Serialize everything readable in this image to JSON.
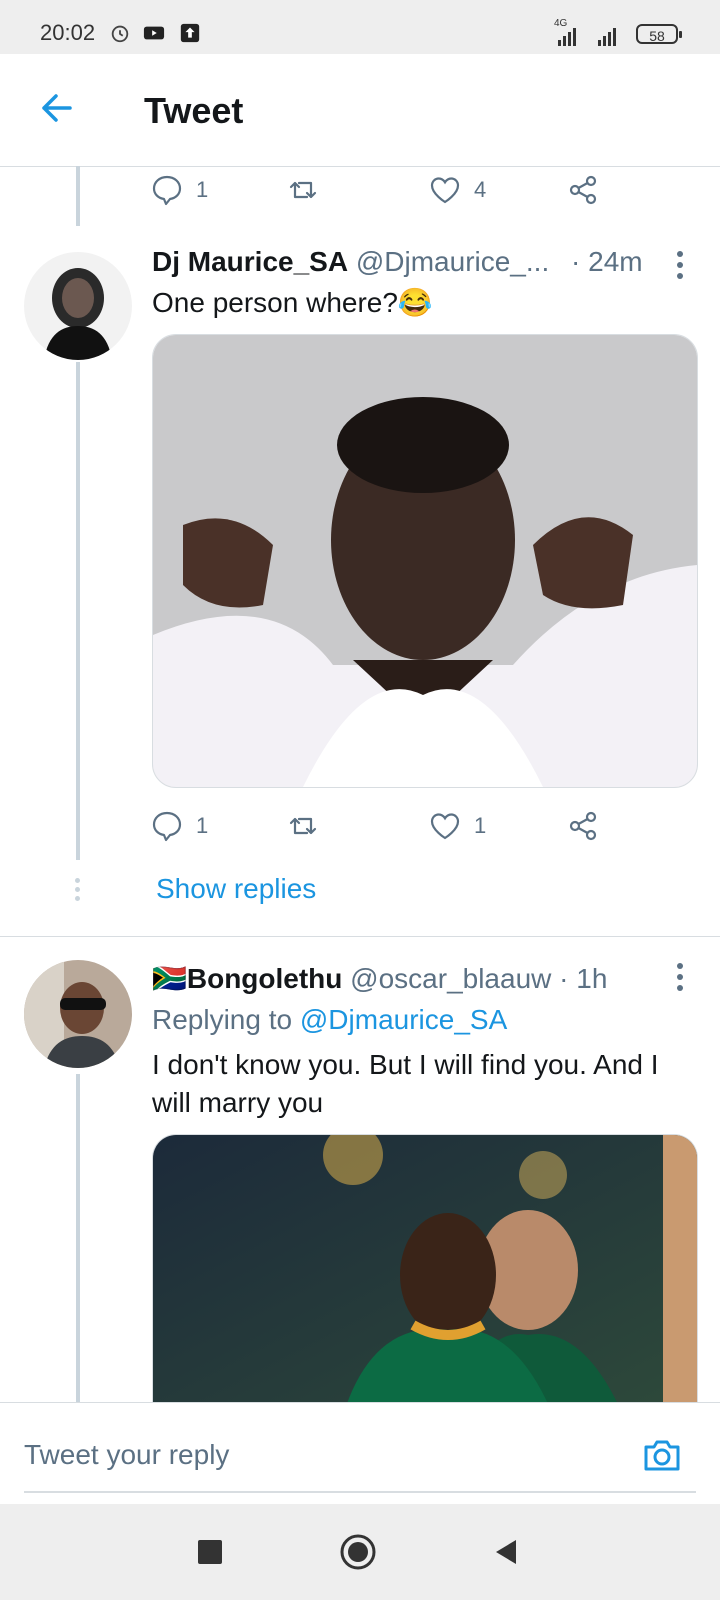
{
  "status": {
    "time": "20:02",
    "battery": "58",
    "network": "4G"
  },
  "header": {
    "title": "Tweet",
    "back_icon": "arrow-left-icon"
  },
  "top_actions": {
    "reply_count": "1",
    "retweet_count": "",
    "like_count": "4"
  },
  "tweet1": {
    "name": "Dj Maurice_SA",
    "handle": "@Djmaurice_...",
    "time": "· 24m",
    "text": "One person where?😂",
    "reply_count": "1",
    "retweet_count": "",
    "like_count": "1",
    "show_replies": "Show replies"
  },
  "tweet2": {
    "name": "🇿🇦Bongolethu",
    "handle": "@oscar_blaauw · 1h",
    "replying_prefix": "Replying to ",
    "replying_to": "@Djmaurice_SA",
    "text": "I don't know you. But I will find you. And I will marry you"
  },
  "reply_box": {
    "placeholder": "Tweet your reply",
    "camera_icon": "camera-icon"
  },
  "colors": {
    "accent": "#1b95e0",
    "text": "#14171a",
    "muted": "#5b7083"
  }
}
